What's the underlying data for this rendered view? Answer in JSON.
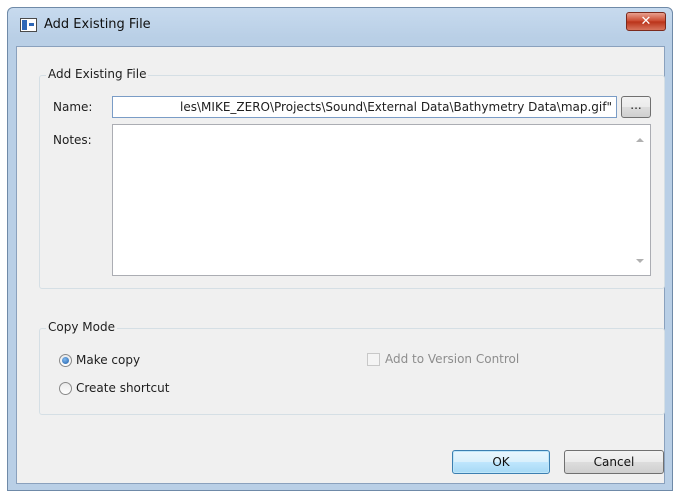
{
  "window": {
    "title": "Add Existing File",
    "close_label": "✕"
  },
  "file_group": {
    "label": "Add Existing File",
    "name_label": "Name:",
    "name_value": "les\\MIKE_ZERO\\Projects\\Sound\\External Data\\Bathymetry Data\\map.gif\"",
    "browse_label": "...",
    "notes_label": "Notes:",
    "notes_value": ""
  },
  "copy_mode": {
    "label": "Copy Mode",
    "make_copy": "Make copy",
    "create_shortcut": "Create shortcut",
    "version_control": "Add to Version Control",
    "selected": "Make copy"
  },
  "buttons": {
    "ok": "OK",
    "cancel": "Cancel"
  }
}
